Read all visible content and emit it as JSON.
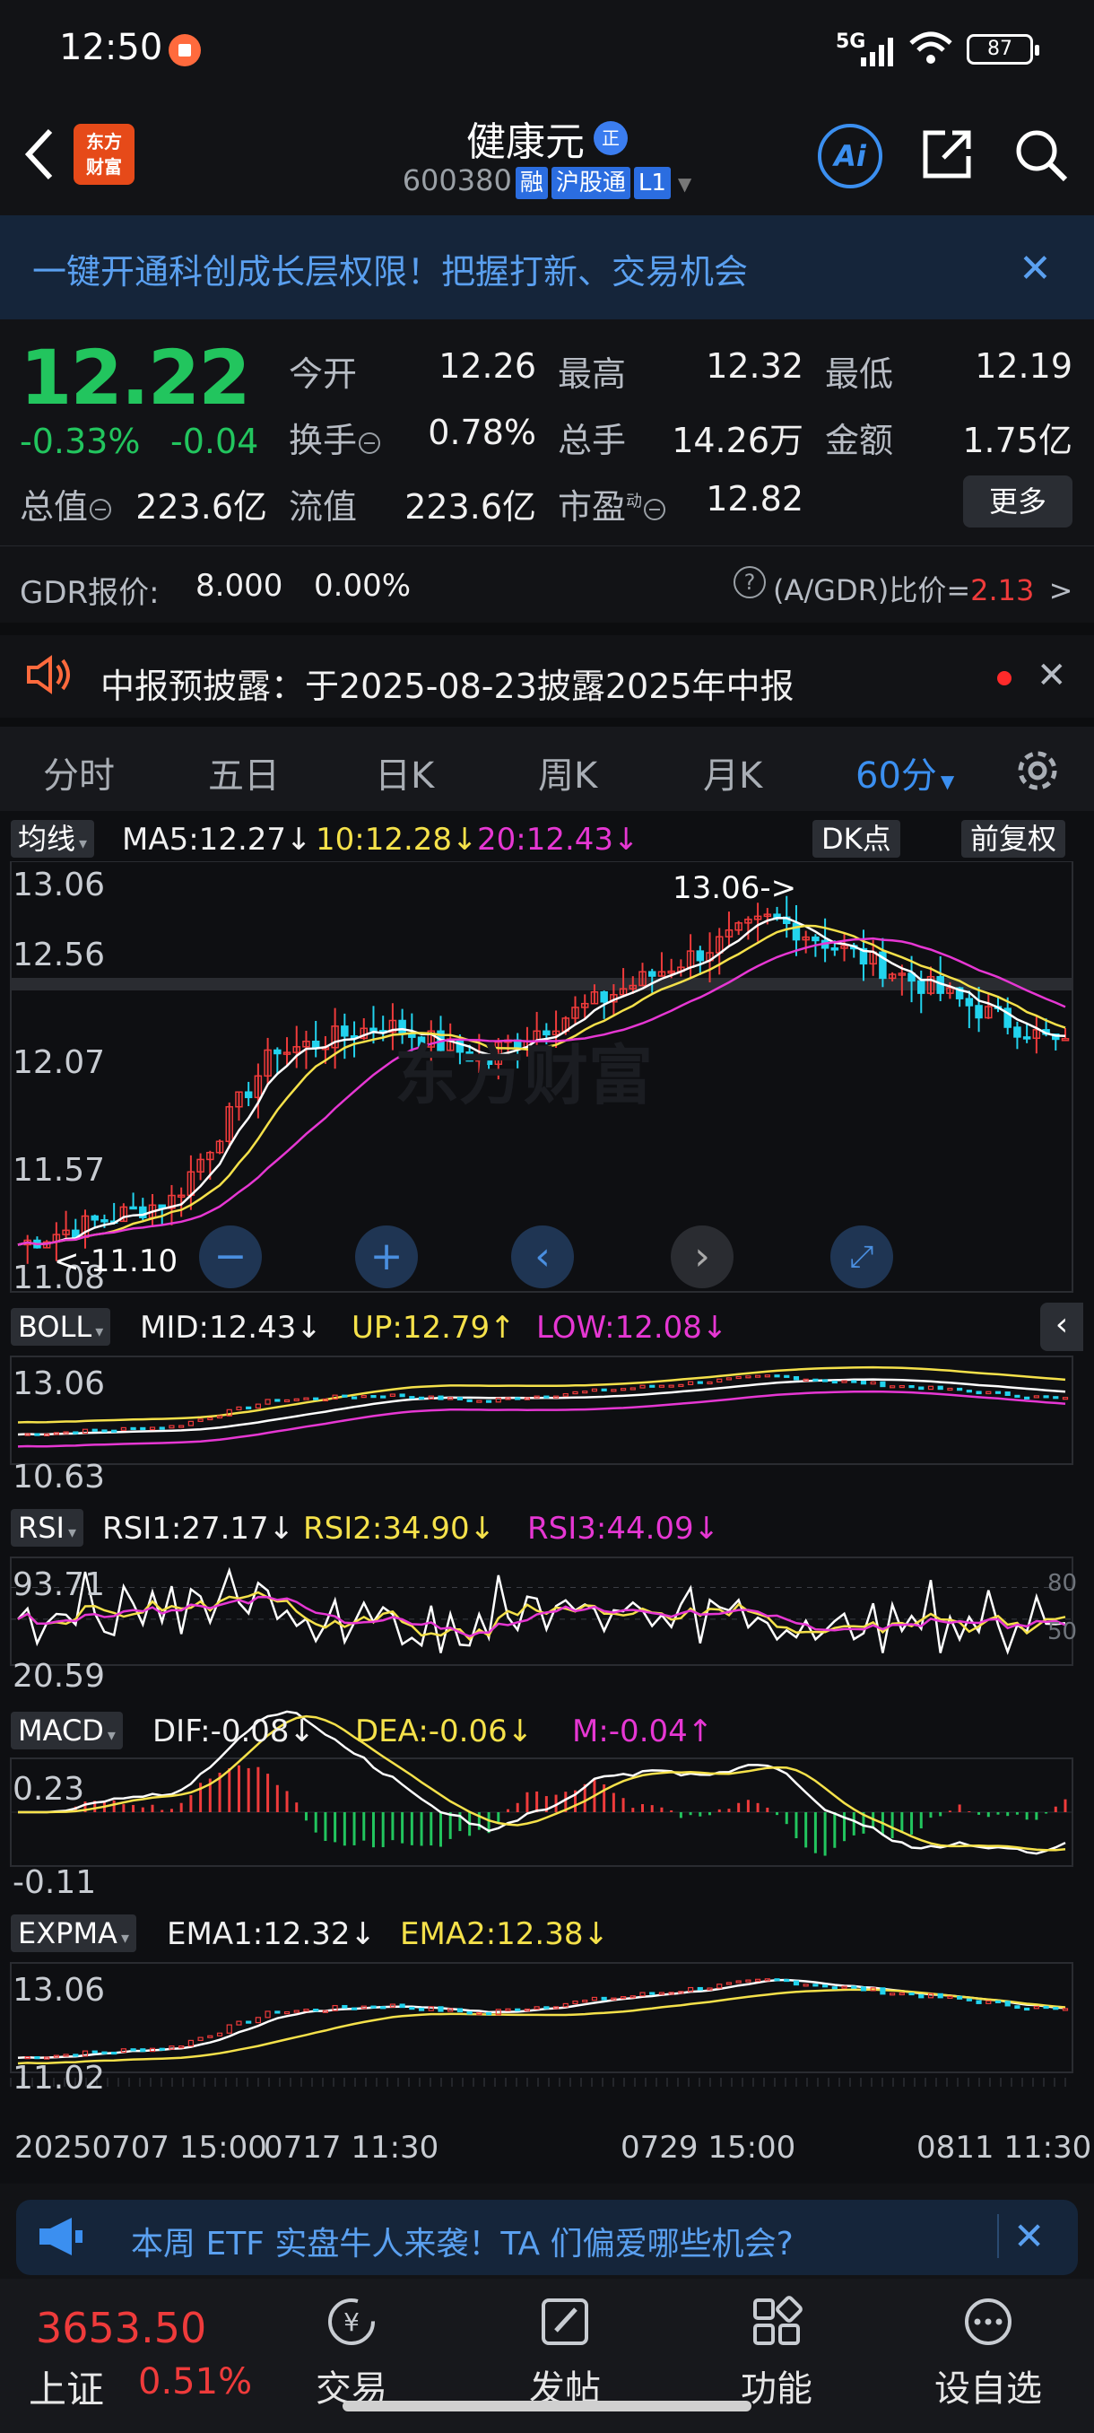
{
  "status_bar": {
    "time": "12:50",
    "network": "5G",
    "battery": "87"
  },
  "header": {
    "logo_text_1": "东方",
    "logo_text_2": "财富",
    "stock_name": "健康元",
    "badge": "正",
    "code": "600380",
    "tags": [
      "融",
      "沪股通",
      "L1"
    ],
    "ai_label": "Ai"
  },
  "banner": {
    "text": "一键开通科创成长层权限！把握打新、交易机会",
    "close": "✕"
  },
  "quote": {
    "price": "12.22",
    "pct": "-0.33%",
    "change": "-0.04",
    "open_label": "今开",
    "open": "12.26",
    "high_label": "最高",
    "high": "12.32",
    "low_label": "最低",
    "low": "12.19",
    "turnover_label": "换手",
    "turnover": "0.78%",
    "volume_label": "总手",
    "volume": "14.26万",
    "amount_label": "金额",
    "amount": "1.75亿",
    "mktcap_label": "总值",
    "mktcap": "223.6亿",
    "float_label": "流值",
    "float": "223.6亿",
    "pe_label": "市盈",
    "pe_sup": "动",
    "pe": "12.82",
    "more": "更多"
  },
  "gdr": {
    "label": "GDR报价:",
    "price": "8.000",
    "pct": "0.00%",
    "ratio_label": "(A/GDR)比价=",
    "ratio": "2.13",
    "arrow": ">"
  },
  "notice": {
    "text": "中报预披露：于2025-08-23披露2025年中报"
  },
  "tabs": [
    "分时",
    "五日",
    "日K",
    "周K",
    "月K",
    "60分"
  ],
  "chart": {
    "ma_btn": "均线",
    "ma_legend": {
      "ma5": "MA5:12.27↓",
      "ma10": "10:12.28↓",
      "ma20": "20:12.43↓"
    },
    "dk_btn": "DK点",
    "adj_btn": "前复权",
    "price_axis": [
      "13.06",
      "12.56",
      "12.07",
      "11.57",
      "11.08"
    ],
    "high_note": "13.06->",
    "low_note": "<-11.10",
    "watermark": "东方财富",
    "boll_btn": "BOLL",
    "boll_legend": {
      "mid": "MID:12.43↓",
      "up": "UP:12.79↑",
      "low": "LOW:12.08↓"
    },
    "boll_axis": [
      "13.06",
      "10.63"
    ],
    "rsi_btn": "RSI",
    "rsi_legend": {
      "r1": "RSI1:27.17↓",
      "r2": "RSI2:34.90↓",
      "r3": "RSI3:44.09↓"
    },
    "rsi_axis": [
      "93.71",
      "20.59"
    ],
    "rsi_levels": [
      "80",
      "50"
    ],
    "macd_btn": "MACD",
    "macd_legend": {
      "dif": "DIF:-0.08↓",
      "dea": "DEA:-0.06↓",
      "m": "M:-0.04↑"
    },
    "macd_axis": [
      "0.23",
      "-0.11"
    ],
    "expma_btn": "EXPMA",
    "expma_legend": {
      "e1": "EMA1:12.32↓",
      "e2": "EMA2:12.38↓"
    },
    "expma_axis": [
      "13.06",
      "11.02"
    ],
    "dates": [
      "20250707 15:00",
      "0717 11:30",
      "0729 15:00",
      "0811 11:30"
    ]
  },
  "ad": {
    "text": "本周 ETF 实盘牛人来袭！TA 们偏爱哪些机会?"
  },
  "bottom_bar": {
    "index_value": "3653.50",
    "index_name": "上证",
    "index_pct": "0.51%",
    "items": [
      "交易",
      "发帖",
      "功能",
      "设自选"
    ]
  },
  "colors": {
    "up": "#ef3b3b",
    "down": "#22c55e",
    "accent": "#3b8ff0",
    "ma10": "#f5e14a",
    "ma20": "#e637d3"
  }
}
